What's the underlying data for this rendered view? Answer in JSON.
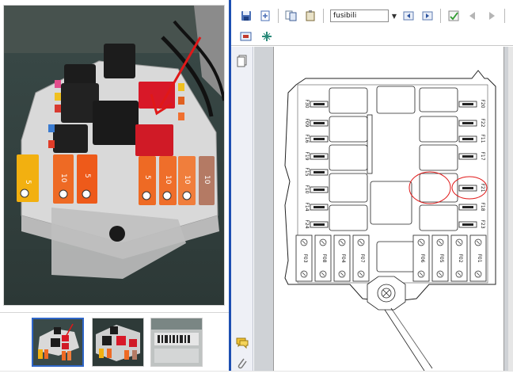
{
  "viewer": {
    "search_value": "fusibili"
  },
  "diagram": {
    "left_fuses": [
      "F30",
      "F09",
      "F16",
      "F19",
      "F15",
      "F10",
      "F14",
      "F24"
    ],
    "right_fuses": [
      "F20",
      "F22",
      "F11",
      "F17",
      "F21",
      "F18",
      "F23"
    ],
    "bottom_fuses": [
      "F03",
      "F08",
      "F04",
      "F07",
      "F06",
      "F05",
      "F02",
      "F01"
    ],
    "highlighted_fuse": "F21"
  },
  "photo": {
    "fuse_labels": [
      "5",
      "10",
      "5",
      "5",
      "10",
      "10",
      "10"
    ]
  },
  "colors": {
    "viewer_accent": "#1d4fb2",
    "annotation_red": "#e01818",
    "fuse_yellow": "#f2b010",
    "fuse_orange": "#ee6a24",
    "fuse_brown": "#b47a64",
    "relay_black": "#1c1c1c"
  },
  "icons": {
    "toolbar": [
      "save-icon",
      "fit-page-icon",
      "copy-icon",
      "paste-icon",
      "search-prev-icon",
      "search-next-icon",
      "spellcheck-icon",
      "back-icon",
      "forward-icon"
    ],
    "toolbar_row2": [
      "hand-tool-icon",
      "select-tool-icon"
    ],
    "nav_rail": [
      "pages-panel-icon",
      "comments-icon",
      "attachment-icon"
    ]
  }
}
